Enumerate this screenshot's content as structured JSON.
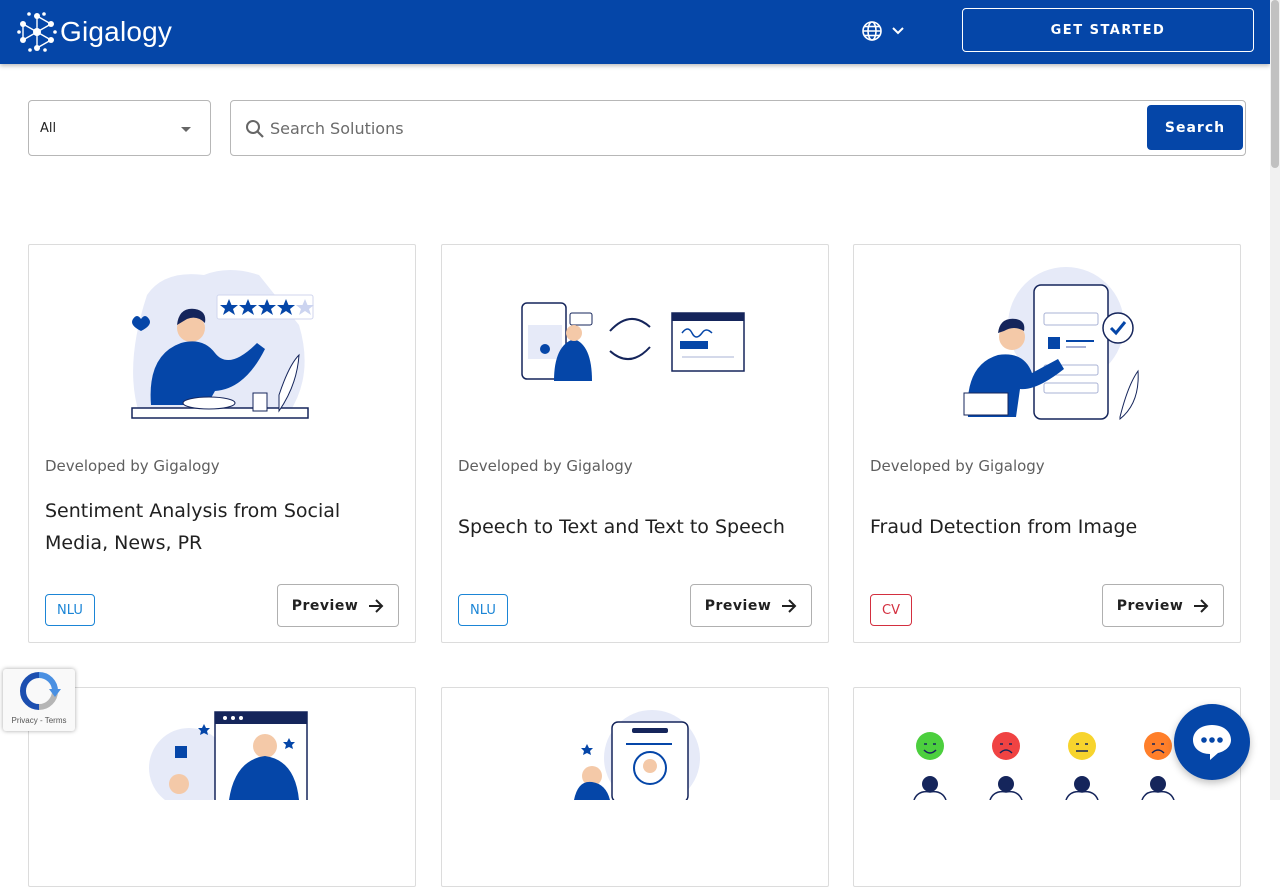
{
  "header": {
    "logo_text": "Gigalogy",
    "get_started_label": "GET STARTED"
  },
  "filter": {
    "selected": "All"
  },
  "search": {
    "placeholder": "Search Solutions",
    "value": "",
    "button_label": "Search"
  },
  "cards": [
    {
      "developer": "Developed by Gigalogy",
      "title": "Sentiment Analysis from Social Media, News, PR",
      "tag": "NLU",
      "preview_label": "Preview"
    },
    {
      "developer": "Developed by Gigalogy",
      "title": "Speech to Text and Text to Speech",
      "tag": "NLU",
      "preview_label": "Preview"
    },
    {
      "developer": "Developed by Gigalogy",
      "title": "Fraud Detection from Image",
      "tag": "CV",
      "preview_label": "Preview"
    }
  ],
  "recaptcha": {
    "links": "Privacy - Terms"
  },
  "colors": {
    "brand": "#0546a8",
    "tag_nlu": "#1b85d6",
    "tag_cv": "#d32f3f"
  }
}
